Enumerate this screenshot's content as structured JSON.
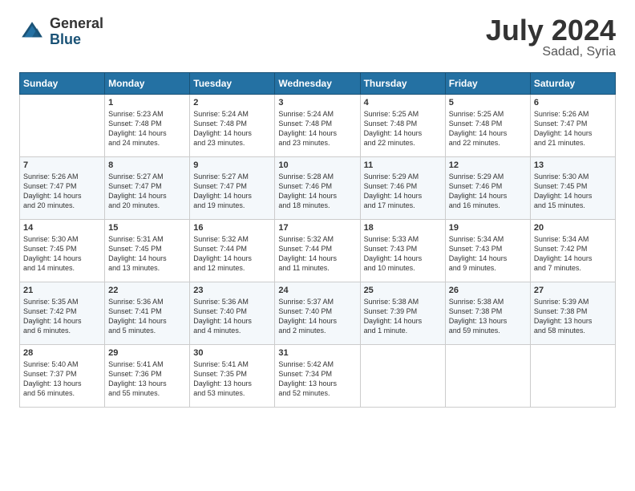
{
  "header": {
    "logo_general": "General",
    "logo_blue": "Blue",
    "month_title": "July 2024",
    "location": "Sadad, Syria"
  },
  "days_of_week": [
    "Sunday",
    "Monday",
    "Tuesday",
    "Wednesday",
    "Thursday",
    "Friday",
    "Saturday"
  ],
  "weeks": [
    [
      {
        "day": "",
        "text": ""
      },
      {
        "day": "1",
        "text": "Sunrise: 5:23 AM\nSunset: 7:48 PM\nDaylight: 14 hours\nand 24 minutes."
      },
      {
        "day": "2",
        "text": "Sunrise: 5:24 AM\nSunset: 7:48 PM\nDaylight: 14 hours\nand 23 minutes."
      },
      {
        "day": "3",
        "text": "Sunrise: 5:24 AM\nSunset: 7:48 PM\nDaylight: 14 hours\nand 23 minutes."
      },
      {
        "day": "4",
        "text": "Sunrise: 5:25 AM\nSunset: 7:48 PM\nDaylight: 14 hours\nand 22 minutes."
      },
      {
        "day": "5",
        "text": "Sunrise: 5:25 AM\nSunset: 7:48 PM\nDaylight: 14 hours\nand 22 minutes."
      },
      {
        "day": "6",
        "text": "Sunrise: 5:26 AM\nSunset: 7:47 PM\nDaylight: 14 hours\nand 21 minutes."
      }
    ],
    [
      {
        "day": "7",
        "text": "Sunrise: 5:26 AM\nSunset: 7:47 PM\nDaylight: 14 hours\nand 20 minutes."
      },
      {
        "day": "8",
        "text": "Sunrise: 5:27 AM\nSunset: 7:47 PM\nDaylight: 14 hours\nand 20 minutes."
      },
      {
        "day": "9",
        "text": "Sunrise: 5:27 AM\nSunset: 7:47 PM\nDaylight: 14 hours\nand 19 minutes."
      },
      {
        "day": "10",
        "text": "Sunrise: 5:28 AM\nSunset: 7:46 PM\nDaylight: 14 hours\nand 18 minutes."
      },
      {
        "day": "11",
        "text": "Sunrise: 5:29 AM\nSunset: 7:46 PM\nDaylight: 14 hours\nand 17 minutes."
      },
      {
        "day": "12",
        "text": "Sunrise: 5:29 AM\nSunset: 7:46 PM\nDaylight: 14 hours\nand 16 minutes."
      },
      {
        "day": "13",
        "text": "Sunrise: 5:30 AM\nSunset: 7:45 PM\nDaylight: 14 hours\nand 15 minutes."
      }
    ],
    [
      {
        "day": "14",
        "text": "Sunrise: 5:30 AM\nSunset: 7:45 PM\nDaylight: 14 hours\nand 14 minutes."
      },
      {
        "day": "15",
        "text": "Sunrise: 5:31 AM\nSunset: 7:45 PM\nDaylight: 14 hours\nand 13 minutes."
      },
      {
        "day": "16",
        "text": "Sunrise: 5:32 AM\nSunset: 7:44 PM\nDaylight: 14 hours\nand 12 minutes."
      },
      {
        "day": "17",
        "text": "Sunrise: 5:32 AM\nSunset: 7:44 PM\nDaylight: 14 hours\nand 11 minutes."
      },
      {
        "day": "18",
        "text": "Sunrise: 5:33 AM\nSunset: 7:43 PM\nDaylight: 14 hours\nand 10 minutes."
      },
      {
        "day": "19",
        "text": "Sunrise: 5:34 AM\nSunset: 7:43 PM\nDaylight: 14 hours\nand 9 minutes."
      },
      {
        "day": "20",
        "text": "Sunrise: 5:34 AM\nSunset: 7:42 PM\nDaylight: 14 hours\nand 7 minutes."
      }
    ],
    [
      {
        "day": "21",
        "text": "Sunrise: 5:35 AM\nSunset: 7:42 PM\nDaylight: 14 hours\nand 6 minutes."
      },
      {
        "day": "22",
        "text": "Sunrise: 5:36 AM\nSunset: 7:41 PM\nDaylight: 14 hours\nand 5 minutes."
      },
      {
        "day": "23",
        "text": "Sunrise: 5:36 AM\nSunset: 7:40 PM\nDaylight: 14 hours\nand 4 minutes."
      },
      {
        "day": "24",
        "text": "Sunrise: 5:37 AM\nSunset: 7:40 PM\nDaylight: 14 hours\nand 2 minutes."
      },
      {
        "day": "25",
        "text": "Sunrise: 5:38 AM\nSunset: 7:39 PM\nDaylight: 14 hours\nand 1 minute."
      },
      {
        "day": "26",
        "text": "Sunrise: 5:38 AM\nSunset: 7:38 PM\nDaylight: 13 hours\nand 59 minutes."
      },
      {
        "day": "27",
        "text": "Sunrise: 5:39 AM\nSunset: 7:38 PM\nDaylight: 13 hours\nand 58 minutes."
      }
    ],
    [
      {
        "day": "28",
        "text": "Sunrise: 5:40 AM\nSunset: 7:37 PM\nDaylight: 13 hours\nand 56 minutes."
      },
      {
        "day": "29",
        "text": "Sunrise: 5:41 AM\nSunset: 7:36 PM\nDaylight: 13 hours\nand 55 minutes."
      },
      {
        "day": "30",
        "text": "Sunrise: 5:41 AM\nSunset: 7:35 PM\nDaylight: 13 hours\nand 53 minutes."
      },
      {
        "day": "31",
        "text": "Sunrise: 5:42 AM\nSunset: 7:34 PM\nDaylight: 13 hours\nand 52 minutes."
      },
      {
        "day": "",
        "text": ""
      },
      {
        "day": "",
        "text": ""
      },
      {
        "day": "",
        "text": ""
      }
    ]
  ]
}
